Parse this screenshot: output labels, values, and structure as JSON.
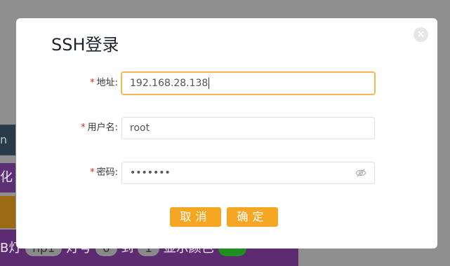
{
  "background": {
    "left_fragment_1": "n三",
    "left_fragment_2": "化",
    "bottom_bar": {
      "prefix": "B灯",
      "chip1": "np1",
      "text1": "灯号",
      "chip2": "0",
      "text2": "到",
      "chip3": "1",
      "text3": "显示颜色"
    }
  },
  "dialog": {
    "title": "SSH登录",
    "close_icon": "close-icon",
    "fields": {
      "address": {
        "required_mark": "*",
        "label": "地址:",
        "value": "192.168.28.138"
      },
      "username": {
        "required_mark": "*",
        "label": "用户名:",
        "value": "root"
      },
      "password": {
        "required_mark": "*",
        "label": "密码:",
        "value": "•••••••",
        "icon": "eye-off-icon"
      }
    },
    "buttons": {
      "cancel": "取消",
      "confirm": "确定"
    },
    "colors": {
      "accent": "#f5a623",
      "focus_border": "#f5b84d",
      "required": "#e02424"
    }
  }
}
